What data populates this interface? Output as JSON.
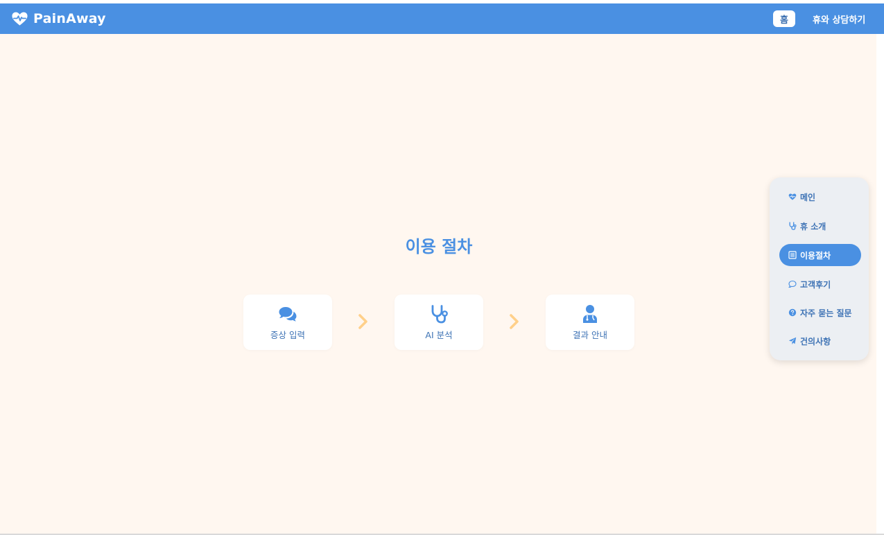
{
  "brand": {
    "name": "PainAway",
    "icon": "heart-pulse-icon"
  },
  "navbar": {
    "home_label": "홈",
    "consult_label": "휴와 상담하기"
  },
  "main": {
    "title": "이용 절차",
    "steps": [
      {
        "icon": "comments-icon",
        "label": "증상 입력"
      },
      {
        "icon": "stethoscope-icon",
        "label": "AI 분석"
      },
      {
        "icon": "doctor-icon",
        "label": "결과 안내"
      }
    ],
    "arrow_icon": "chevron-right-icon"
  },
  "sidebar": {
    "items": [
      {
        "icon": "heart-pulse-icon",
        "label": "메인",
        "active": false
      },
      {
        "icon": "stethoscope-icon",
        "label": "휴 소개",
        "active": false
      },
      {
        "icon": "list-icon",
        "label": "이용절차",
        "active": true
      },
      {
        "icon": "comment-icon",
        "label": "고객후기",
        "active": false
      },
      {
        "icon": "question-circle-icon",
        "label": "자주 묻는 질문",
        "active": false
      },
      {
        "icon": "paper-plane-icon",
        "label": "건의사항",
        "active": false
      }
    ]
  },
  "colors": {
    "primary": "#4a90e2",
    "background": "#fff7f0",
    "arrow": "#ffd08a",
    "sidebar_bg": "#eceff3"
  }
}
